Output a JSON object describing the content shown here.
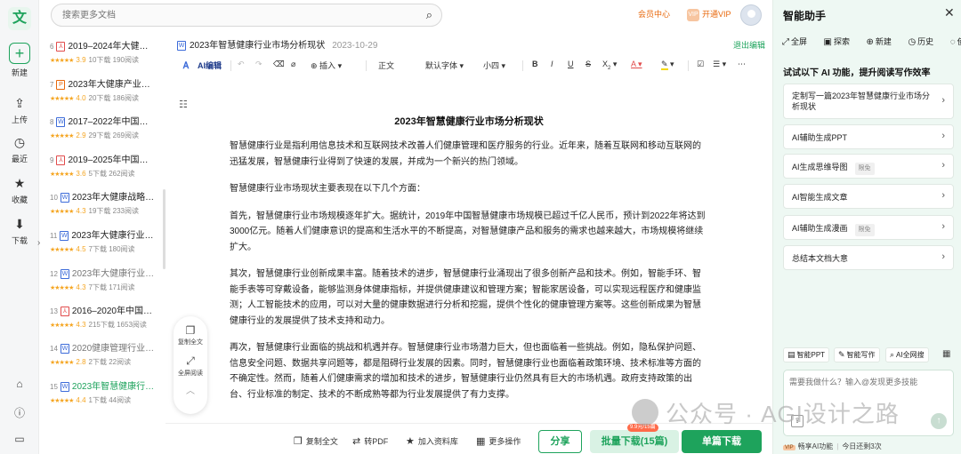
{
  "app": {
    "logo": "文"
  },
  "rail": {
    "items": [
      {
        "label": "新建",
        "icon": "plus-icon"
      },
      {
        "label": "上传",
        "icon": "upload-icon"
      },
      {
        "label": "最近",
        "icon": "clock-icon"
      },
      {
        "label": "收藏",
        "icon": "star-icon"
      },
      {
        "label": "下载",
        "icon": "download-icon"
      }
    ],
    "bottom_icons": [
      "bag-icon",
      "help-icon",
      "monitor-icon"
    ]
  },
  "search": {
    "placeholder": "搜索更多文档"
  },
  "header": {
    "member_center": "会员中心",
    "open_vip": "开通VIP"
  },
  "doc_list": [
    {
      "num": "6",
      "type": "pdf",
      "title": "2019–2024年大健…",
      "score": "3.9",
      "downloads": "10下载",
      "reads": "190阅读",
      "dim": false
    },
    {
      "num": "7",
      "type": "ppt",
      "title": "2023年大健康产业…",
      "score": "4.0",
      "downloads": "20下载",
      "reads": "186阅读",
      "dim": false
    },
    {
      "num": "8",
      "type": "doc",
      "title": "2017–2022年中国…",
      "score": "2.9",
      "downloads": "29下载",
      "reads": "269阅读",
      "dim": false
    },
    {
      "num": "9",
      "type": "pdf",
      "title": "2019–2025年中国…",
      "score": "3.6",
      "downloads": "5下载",
      "reads": "262阅读",
      "dim": false
    },
    {
      "num": "10",
      "type": "doc",
      "title": "2023年大健康战略…",
      "score": "4.3",
      "downloads": "19下载",
      "reads": "233阅读",
      "dim": false
    },
    {
      "num": "11",
      "type": "doc",
      "title": "2023年大健康行业…",
      "score": "4.5",
      "downloads": "7下载",
      "reads": "180阅读",
      "dim": false
    },
    {
      "num": "12",
      "type": "doc",
      "title": "2023年大健康行业…",
      "score": "4.3",
      "downloads": "7下载",
      "reads": "171阅读",
      "dim": true
    },
    {
      "num": "13",
      "type": "pdf",
      "title": "2016–2020年中国…",
      "score": "4.3",
      "downloads": "215下载",
      "reads": "1653阅读",
      "dim": false
    },
    {
      "num": "14",
      "type": "doc",
      "title": "2020健康管理行业…",
      "score": "2.8",
      "downloads": "2下载",
      "reads": "22阅读",
      "dim": true
    },
    {
      "num": "15",
      "type": "doc",
      "title": "2023年智慧健康行…",
      "score": "4.4",
      "downloads": "1下载",
      "reads": "44阅读",
      "dim": false,
      "active": true
    }
  ],
  "float_bar": {
    "copy_all": "复制全文",
    "fullscreen_read": "全屏阅读"
  },
  "document": {
    "title": "2023年智慧健康行业市场分析现状",
    "date": "2023-10-29",
    "exit_edit": "退出编辑",
    "heading": "2023年智慧健康行业市场分析现状",
    "paragraphs": [
      "智慧健康行业是指利用信息技术和互联网技术改善人们健康管理和医疗服务的行业。近年来，随着互联网和移动互联网的迅猛发展，智慧健康行业得到了快速的发展，并成为一个新兴的热门领域。",
      "智慧健康行业市场现状主要表现在以下几个方面：",
      "首先，智慧健康行业市场规模逐年扩大。据统计，2019年中国智慧健康市场规模已超过千亿人民币，预计到2022年将达到3000亿元。随着人们健康意识的提高和生活水平的不断提高，对智慧健康产品和服务的需求也越来越大，市场规模将继续扩大。",
      "其次，智慧健康行业创新成果丰富。随着技术的进步，智慧健康行业涌现出了很多创新产品和技术。例如，智能手环、智能手表等可穿戴设备，能够监测身体健康指标，并提供健康建议和管理方案；智能家居设备，可以实现远程医疗和健康监测；人工智能技术的应用，可以对大量的健康数据进行分析和挖掘，提供个性化的健康管理方案等。这些创新成果为智慧健康行业的发展提供了技术支持和动力。",
      "再次，智慧健康行业面临的挑战和机遇并存。智慧健康行业市场潜力巨大，但也面临着一些挑战。例如，隐私保护问题、信息安全问题、数据共享问题等，都是阻碍行业发展的因素。同时，智慧健康行业也面临着政策环境、技术标准等方面的不确定性。然而，随着人们健康需求的增加和技术的进步，智慧健康行业仍然具有巨大的市场机遇。政府支持政策的出台、行业标准的制定、技术的不断成熟等都为行业发展提供了有力支撑。"
    ]
  },
  "toolbar": {
    "ai_edit": "AI编辑",
    "insert": "插入",
    "para_style": "正文",
    "font": "默认字体",
    "size": "小四"
  },
  "bottom_bar": {
    "copy_all": "复制全文",
    "to_pdf": "转PDF",
    "add_library": "加入资料库",
    "more": "更多操作",
    "share": "分享",
    "batch_download": "批量下载(15篇)",
    "batch_tag": "9.9元/15篇",
    "single_download": "单篇下载"
  },
  "assistant": {
    "title": "智能助手",
    "tools": [
      "全屏",
      "探索",
      "新建",
      "历史",
      "使用"
    ],
    "hint": "试试以下 AI 功能，提升阅读写作效率",
    "cards": [
      {
        "label": "定制写一篇2023年智慧健康行业市场分析现状",
        "free": ""
      },
      {
        "label": "AI辅助生成PPT",
        "free": ""
      },
      {
        "label": "AI生成思维导图",
        "free": "限免"
      },
      {
        "label": "AI智能生成文章",
        "free": ""
      },
      {
        "label": "AI辅助生成漫画",
        "free": "限免"
      },
      {
        "label": "总结本文档大意",
        "free": ""
      }
    ],
    "quick": [
      "智能PPT",
      "智能写作",
      "AI全网搜"
    ],
    "input_placeholder": "需要我做什么？输入@发现更多技能",
    "foot_vip": "VIP",
    "foot_text": "畅享AI功能",
    "foot_remaining": "今日还剩3次"
  },
  "watermark": "公众号 · AGI设计之路"
}
